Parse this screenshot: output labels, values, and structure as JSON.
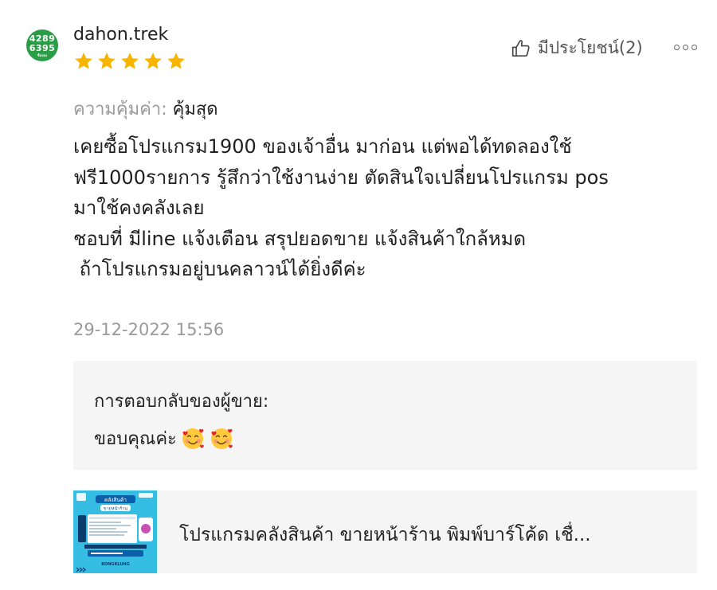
{
  "review": {
    "avatar": {
      "line1": "4289",
      "line2": "6395",
      "line3": "ซื้อของ"
    },
    "username": "dahon.trek",
    "rating": 5,
    "helpful_label": "มีประโยชน์(2)",
    "value_label": "ความคุ้มค่า:",
    "value_text": "คุ้มสุด",
    "body_lines": [
      "เคยซื้อโปรแกรม1900 ของเจ้าอื่น มาก่อน แต่พอได้ทดลองใช้",
      "ฟรี1000รายการ รู้สึกว่าใช้งานง่าย ตัดสินใจเปลี่ยนโปรแกรม pos",
      "มาใช้คงคลังเลย",
      "ชอบที่ มีline แจ้งเตือน สรุปยอดขาย แจ้งสินค้าใกล้หมด",
      " ถ้าโปรแกรมอยู่บนคลาวน์ได้ยิ่งดีค่ะ"
    ],
    "date": "29-12-2022 15:56"
  },
  "seller_reply": {
    "label": "การตอบกลับของผู้ขาย:",
    "text": "ขอบคุณค่ะ"
  },
  "product": {
    "title": "โปรแกรมคลังสินค้า ขายหน้าร้าน พิมพ์บาร์โค้ด เชื่...",
    "thumb_heading": "คลังสินค้า",
    "thumb_sub": "ขายหน้าร้าน",
    "thumb_brand": "KONGKLUNG"
  },
  "colors": {
    "star": "#f7b500",
    "avatar_bg": "#2a9d47",
    "muted_text": "#9a9a9a",
    "panel_bg": "#f5f5f5",
    "thumb_bg": "#35bde4"
  }
}
